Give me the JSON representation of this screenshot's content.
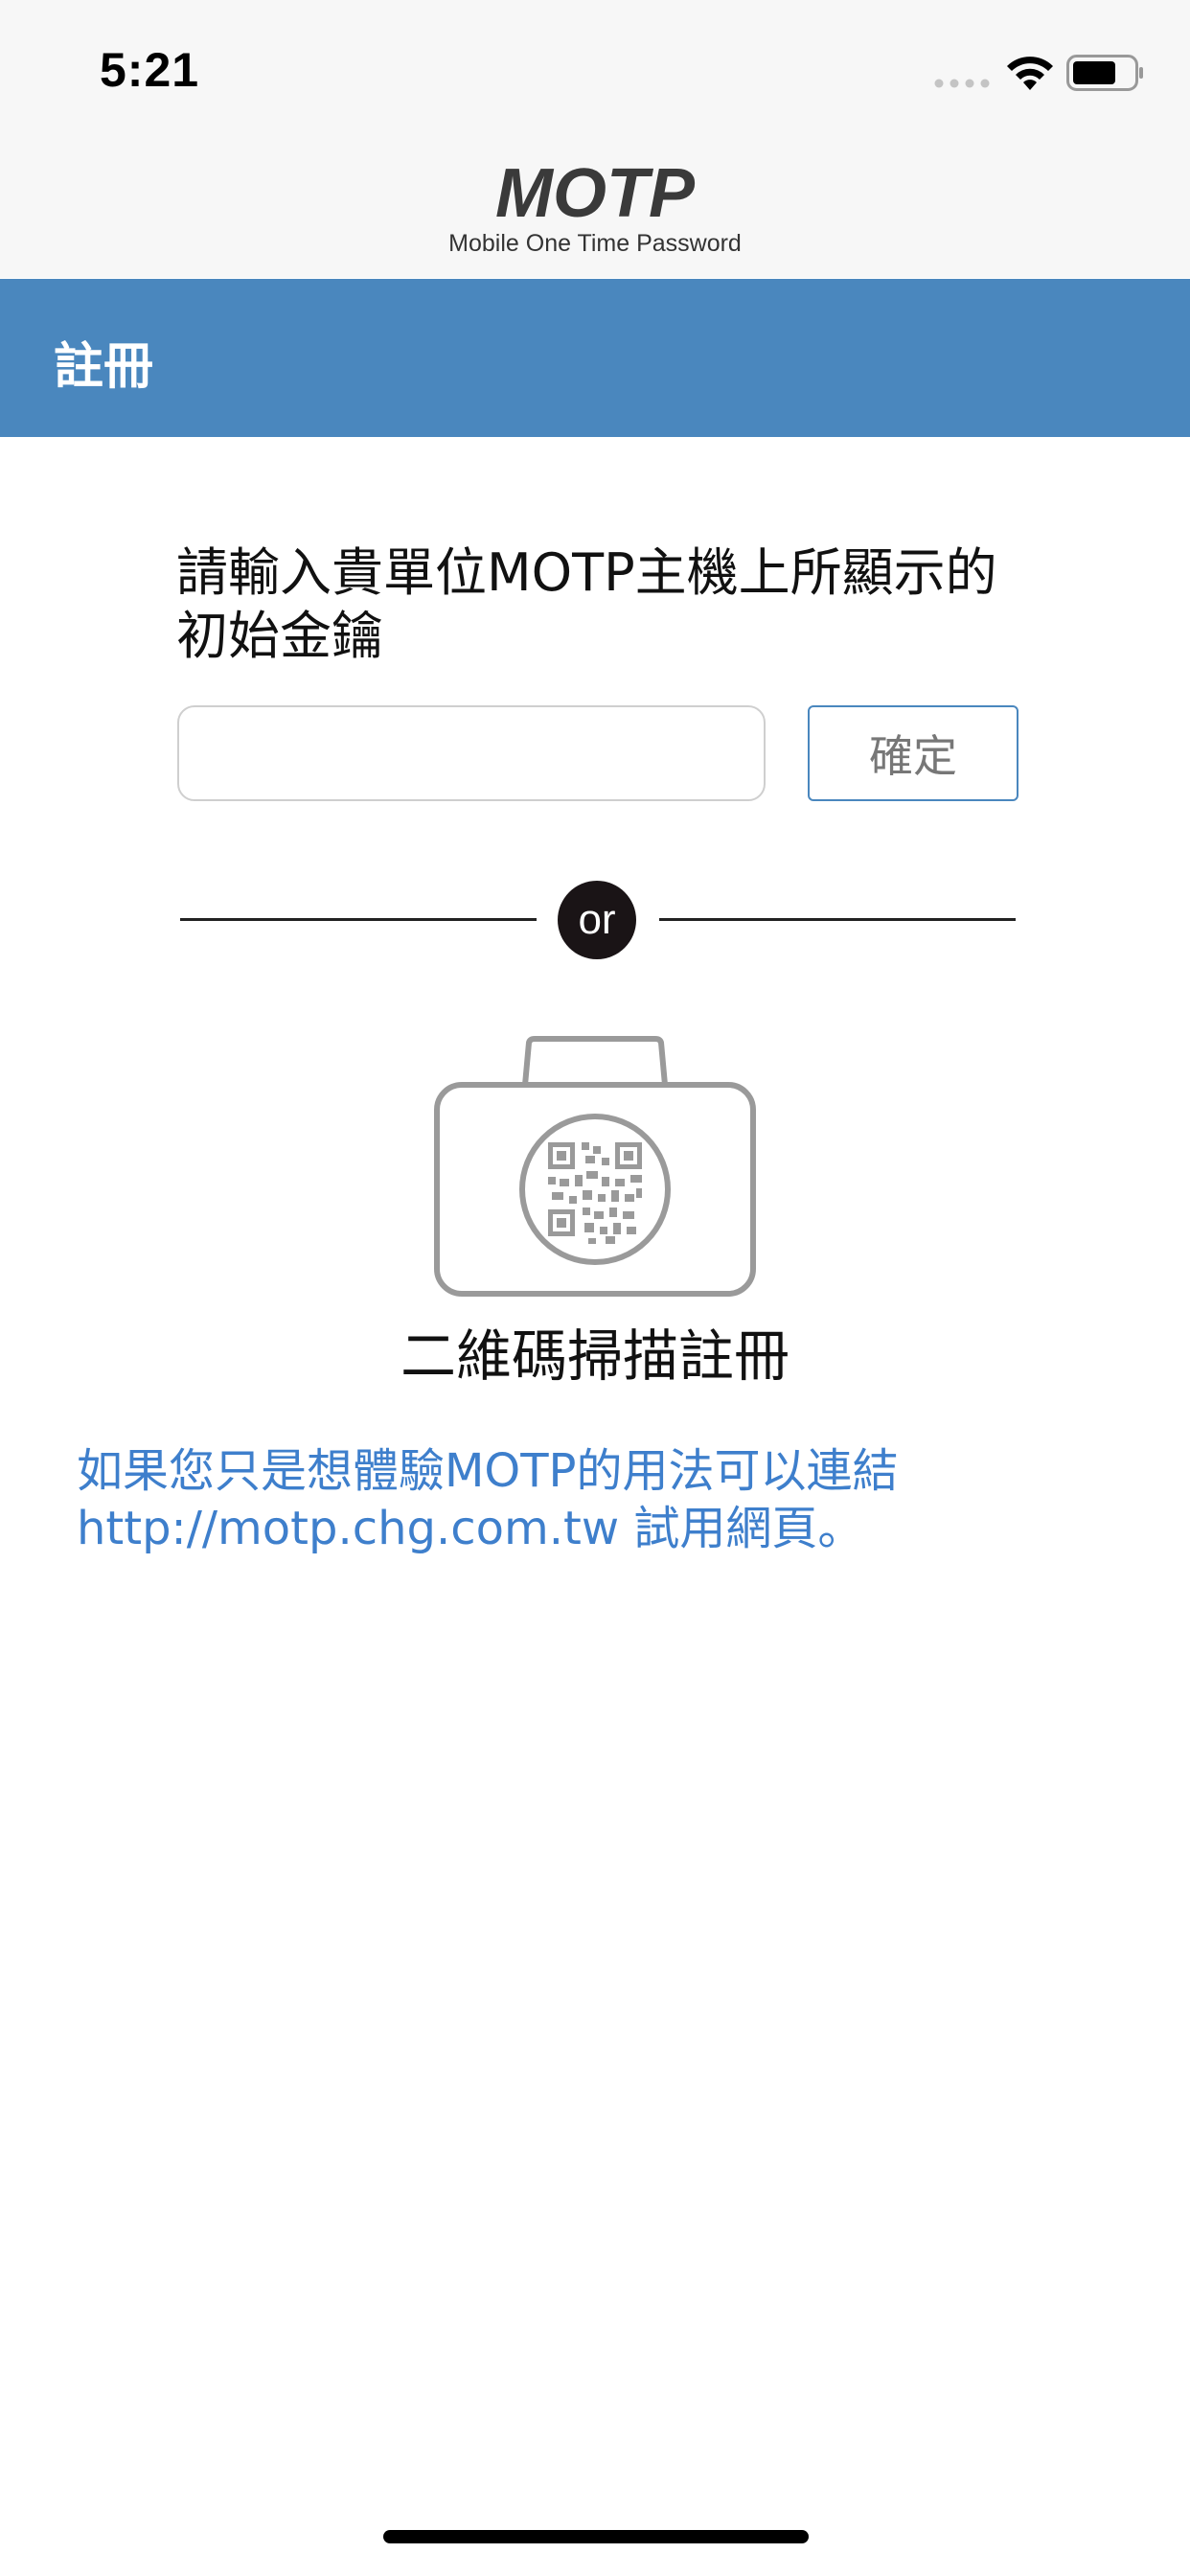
{
  "status_bar": {
    "time": "5:21",
    "icons": [
      "signal-dots-icon",
      "wifi-icon",
      "battery-icon"
    ]
  },
  "header": {
    "logo_text": "MOTP",
    "logo_subtitle": "Mobile One Time Password"
  },
  "nav": {
    "title": "註冊"
  },
  "registration": {
    "instruction": "請輸入貴單位MOTP主機上所顯示的初始金鑰",
    "key_input_value": "",
    "key_input_placeholder": "",
    "confirm_label": "確定"
  },
  "divider": {
    "label": "or"
  },
  "qr_scan": {
    "icon": "camera-qr-icon",
    "label": "二維碼掃描註冊"
  },
  "trial": {
    "text_before": "如果您只是想體驗MOTP的用法可以連結",
    "link_text": "http://motp.chg.com.tw",
    "text_after": " 試用網頁。"
  },
  "colors": {
    "nav_bar": "#4a87be",
    "link": "#3e7fcc",
    "or_badge": "#1a1416",
    "header_bg": "#f7f7f7"
  }
}
